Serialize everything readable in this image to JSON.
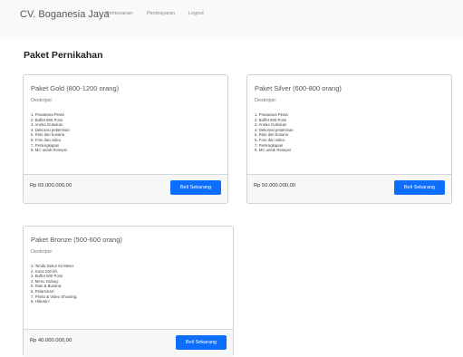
{
  "navbar": {
    "brand": "CV. Boganesia Jaya",
    "links": [
      "Pemesanan",
      "Pembayaran",
      "Logout"
    ]
  },
  "page_title": "Paket Pernikahan",
  "packages": [
    {
      "title": "Paket Gold (800-1200 orang)",
      "desc_label": "Deskripsi:",
      "items": [
        "1. Prasarana Pesta",
        "2. Buffet 800 Porsi",
        "3. Aneka Gubukan",
        "4. Dekorasi pelaminan",
        "5. Rias dan busana",
        "6. Foto dan video",
        "7. Perlengkapan",
        "8. MC untuk Resepsi"
      ],
      "price": "Rp 65.000.000,00",
      "button": "Beli Sekarang"
    },
    {
      "title": "Paket Silver (600-800 orang)",
      "desc_label": "Deskripsi:",
      "items": [
        "1. Prasarana Pesta",
        "2. Buffet 800 Porsi",
        "3. Aneka Gubukan",
        "4. Dekorasi pelaminan",
        "5. Rias dan busana",
        "6. Foto dan video",
        "7. Perlengkapan",
        "8. MC untuk Resepsi"
      ],
      "price": "Rp 50.000.000,00",
      "button": "Beli Sekarang"
    },
    {
      "title": "Paket Bronze (500-600 orang)",
      "desc_label": "Deskripsi:",
      "items": [
        "1. Tenda Dekor 64 Meter.",
        "2. Kursi 100 bh.",
        "3. Buffet 500 Porsi",
        "4. Menu Gubug:",
        "5. Rias & Busana:",
        "6. Pelaminan:",
        "7. Photo & Video Shooting:",
        "8. Hiburan:"
      ],
      "price": "Rp 40.000.000,00",
      "button": "Beli Sekarang"
    }
  ]
}
